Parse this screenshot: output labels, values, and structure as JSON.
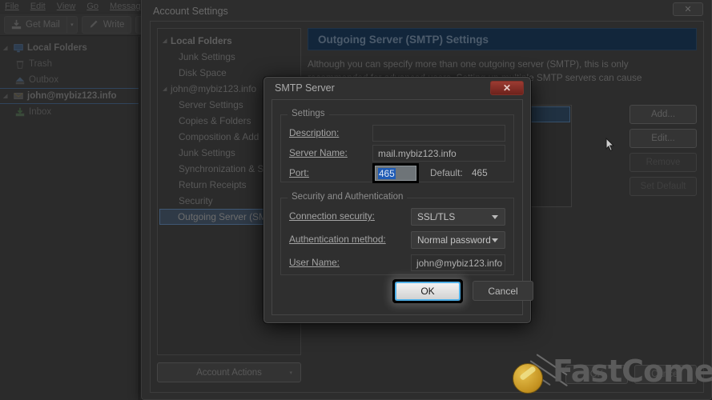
{
  "app": {
    "menubar": [
      "File",
      "Edit",
      "View",
      "Go",
      "Message"
    ],
    "toolbar": {
      "get_mail": "Get Mail",
      "write": "Write",
      "get_mail_icon": "download-icon",
      "write_icon": "pencil-icon",
      "address_icon": "address-book-icon",
      "split_caret": "▾"
    },
    "search": {
      "icon": "search-icon",
      "value": "",
      "placeholder": ""
    }
  },
  "folder_pane": {
    "items": [
      {
        "label": "Local Folders",
        "icon": "computer-icon",
        "twisty": "◢",
        "level": 0,
        "type": "root"
      },
      {
        "label": "Trash",
        "icon": "trash-icon",
        "level": 1,
        "type": "folder"
      },
      {
        "label": "Outbox",
        "icon": "outbox-icon",
        "level": 1,
        "type": "folder"
      },
      {
        "label": "john@mybiz123.info",
        "icon": "mail-account-icon",
        "twisty": "◢",
        "level": 0,
        "type": "account"
      },
      {
        "label": "Inbox",
        "icon": "inbox-icon",
        "level": 1,
        "type": "folder"
      }
    ]
  },
  "account_settings": {
    "title": "Account Settings",
    "close_icon": "close-icon",
    "close_label": "✕",
    "tree": [
      {
        "label": "Local Folders",
        "twisty": "◢",
        "bold": true,
        "child": false,
        "selected": false
      },
      {
        "label": "Junk Settings",
        "bold": false,
        "child": true,
        "selected": false
      },
      {
        "label": "Disk Space",
        "bold": false,
        "child": true,
        "selected": false
      },
      {
        "label": "john@mybiz123.info",
        "twisty": "◢",
        "bold": false,
        "child": false,
        "selected": false
      },
      {
        "label": "Server Settings",
        "bold": false,
        "child": true,
        "selected": false
      },
      {
        "label": "Copies & Folders",
        "bold": false,
        "child": true,
        "selected": false
      },
      {
        "label": "Composition & Add",
        "bold": false,
        "child": true,
        "selected": false
      },
      {
        "label": "Junk Settings",
        "bold": false,
        "child": true,
        "selected": false
      },
      {
        "label": "Synchronization & S",
        "bold": false,
        "child": true,
        "selected": false
      },
      {
        "label": "Return Receipts",
        "bold": false,
        "child": true,
        "selected": false
      },
      {
        "label": "Security",
        "bold": false,
        "child": true,
        "selected": false
      },
      {
        "label": "Outgoing Server (SMTP)",
        "bold": false,
        "child": true,
        "selected": true
      }
    ],
    "account_actions": {
      "label": "Account Actions",
      "caret": "▾"
    },
    "pane": {
      "header": "Outgoing Server (SMTP) Settings",
      "description": "Although you can specify more than one outgoing server (SMTP), this is only recommended for advanced users. Setting up multiple SMTP servers can cause errors when sending messages."
    },
    "side_buttons": [
      {
        "label": "Add...",
        "enabled": true
      },
      {
        "label": "Edit...",
        "enabled": true
      },
      {
        "label": "Remove",
        "enabled": false
      },
      {
        "label": "Set Default",
        "enabled": false
      }
    ],
    "footer_buttons": [
      {
        "label": "OK"
      },
      {
        "label": "Cancel"
      }
    ]
  },
  "smtp_dialog": {
    "title": "SMTP Server",
    "close_label": "✕",
    "close_icon": "close-icon",
    "settings_legend": "Settings",
    "security_legend": "Security and Authentication",
    "fields": {
      "description_label": "Description:",
      "description_value": "",
      "server_name_label": "Server Name:",
      "server_name_value": "mail.mybiz123.info",
      "port_label": "Port:",
      "port_value": "465",
      "port_default_label": "Default:",
      "port_default_value": "465",
      "connection_security_label": "Connection security:",
      "connection_security_value": "SSL/TLS",
      "auth_method_label": "Authentication method:",
      "auth_method_value": "Normal password",
      "user_name_label": "User Name:",
      "user_name_value": "john@mybiz123.info"
    },
    "buttons": {
      "ok": "OK",
      "cancel": "Cancel"
    }
  },
  "watermark": {
    "text": "FastComet",
    "icon": "comet-icon"
  },
  "colors": {
    "pane_header_bg": "#12263b",
    "selection_blue": "#1f5bb5",
    "focus_blue": "#4fb0e8",
    "close_red": "#9b3b32",
    "watermark_gold": "#c2901f"
  }
}
